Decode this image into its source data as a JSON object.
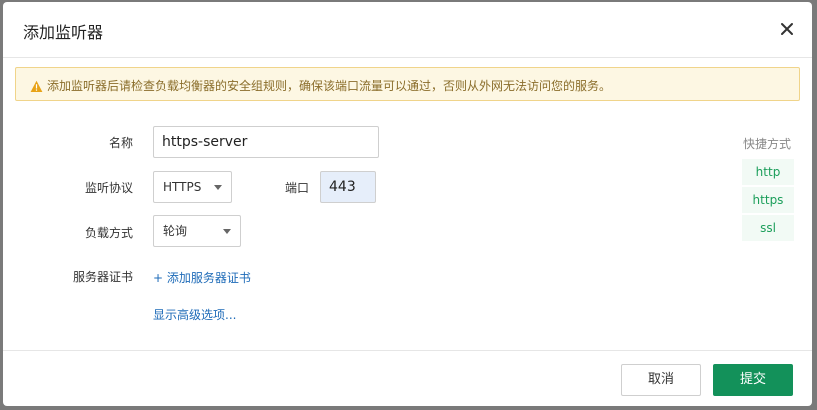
{
  "dialog": {
    "title": "添加监听器"
  },
  "warning": {
    "text": "添加监听器后请检查负载均衡器的安全组规则，确保该端口流量可以通过，否则从外网无法访问您的服务。"
  },
  "form": {
    "name_label": "名称",
    "name_value": "https-server",
    "protocol_label": "监听协议",
    "protocol_value": "HTTPS",
    "port_label": "端口",
    "port_value": "443",
    "balance_label": "负载方式",
    "balance_value": "轮询",
    "cert_label": "服务器证书",
    "add_cert_link": "+ 添加服务器证书",
    "advanced_link": "显示高级选项..."
  },
  "shortcuts": {
    "title": "快捷方式",
    "items": [
      "http",
      "https",
      "ssl"
    ]
  },
  "footer": {
    "cancel_label": "取消",
    "submit_label": "提交"
  },
  "colors": {
    "accent": "#13915a",
    "link": "#1e6bb8",
    "warning_bg": "#fdf7e3"
  }
}
